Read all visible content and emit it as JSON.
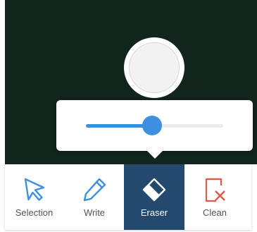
{
  "slider": {
    "value_fraction": 0.48
  },
  "toolbar": {
    "tools": [
      {
        "label": "Selection",
        "icon": "cursor-arrow-icon",
        "color": "#3d8fe0"
      },
      {
        "label": "Write",
        "icon": "pencil-icon",
        "color": "#3d8fe0"
      },
      {
        "label": "Eraser",
        "icon": "eraser-icon",
        "color": "#ffffff",
        "selected": true
      },
      {
        "label": "Clean",
        "icon": "clear-page-icon",
        "color": "#e0574b"
      }
    ]
  },
  "colors": {
    "canvas_background": "#11251d",
    "accent": "#3d8fe0",
    "selected_tool_background": "#23496f",
    "clean_icon": "#e0574b"
  }
}
